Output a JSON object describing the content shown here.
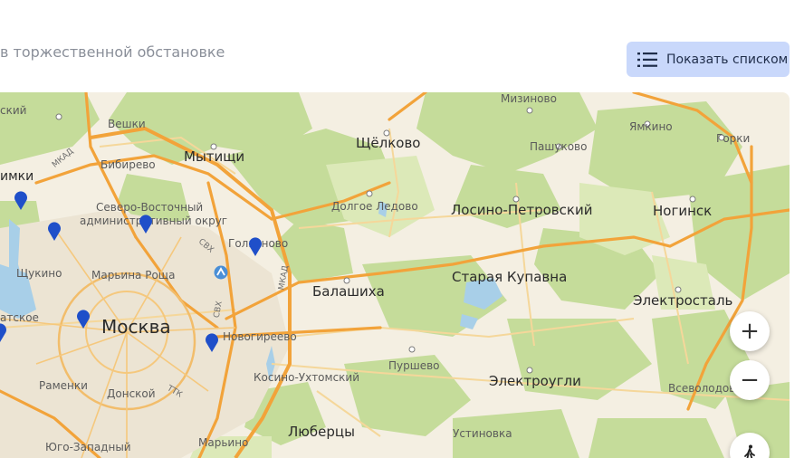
{
  "header": {
    "subtitle": "в торжественной обстановке",
    "list_button_label": "Показать списком"
  },
  "map": {
    "places": [
      {
        "key": "mizinovo",
        "name": "Мизиново"
      },
      {
        "key": "veshki",
        "name": "Вешки"
      },
      {
        "key": "shchyolkovo",
        "name": "Щёлково"
      },
      {
        "key": "yamkino",
        "name": "Ямкино"
      },
      {
        "key": "gorki",
        "name": "Горки"
      },
      {
        "key": "pashukovo",
        "name": "Пашуково"
      },
      {
        "key": "bibirevo",
        "name": "Бибирево"
      },
      {
        "key": "mytishchi",
        "name": "Мытищи"
      },
      {
        "key": "khimki",
        "name": "имки"
      },
      {
        "key": "khimki2",
        "name": "ский"
      },
      {
        "key": "dolgoe",
        "name": "Долгое Ледово"
      },
      {
        "key": "losino",
        "name": "Лосино-Петровский"
      },
      {
        "key": "noginsk",
        "name": "Ногинск"
      },
      {
        "key": "svao1",
        "name": "Северо-Восточный"
      },
      {
        "key": "svao2",
        "name": "административный округ"
      },
      {
        "key": "golyanovo",
        "name": "Гольяново"
      },
      {
        "key": "shchukino",
        "name": "Щукино"
      },
      {
        "key": "maryina",
        "name": "Марьина Роща"
      },
      {
        "key": "staraya",
        "name": "Старая Купавна"
      },
      {
        "key": "balashikha",
        "name": "Балашиха"
      },
      {
        "key": "elektrostal",
        "name": "Электросталь"
      },
      {
        "key": "moskva",
        "name": "Москва"
      },
      {
        "key": "novogireevo",
        "name": "Новогиреево"
      },
      {
        "key": "atskoe",
        "name": "атское"
      },
      {
        "key": "purshevo",
        "name": "Пуршево"
      },
      {
        "key": "kosino",
        "name": "Косино-Ухтомский"
      },
      {
        "key": "elektrougli",
        "name": "Электроугли"
      },
      {
        "key": "vsevolodovo",
        "name": "Всеволодово"
      },
      {
        "key": "ramenki",
        "name": "Раменки"
      },
      {
        "key": "donskoy",
        "name": "Донской"
      },
      {
        "key": "lyubertsy",
        "name": "Люберцы"
      },
      {
        "key": "ustinovka",
        "name": "Устиновка"
      },
      {
        "key": "yugo",
        "name": "Юго-Западный"
      },
      {
        "key": "maryino",
        "name": "Марьино"
      }
    ],
    "road_labels": {
      "mkad": "МКАД",
      "mkad2": "МКАД",
      "svkh": "СВХ",
      "svkh2": "СВХ",
      "ttk": "ТТК"
    }
  },
  "controls": {
    "zoom_in": "+",
    "zoom_out": "−"
  },
  "colors": {
    "pin": "#1f4fc9",
    "button_bg": "#c9d8fb",
    "road": "#f2a33a",
    "forest": "#c5dc9a",
    "water": "#a8cfe8"
  },
  "icons": {
    "list": "list-icon",
    "pin": "map-pin-icon",
    "metro": "metro-icon",
    "pedestrian": "pedestrian-icon"
  }
}
